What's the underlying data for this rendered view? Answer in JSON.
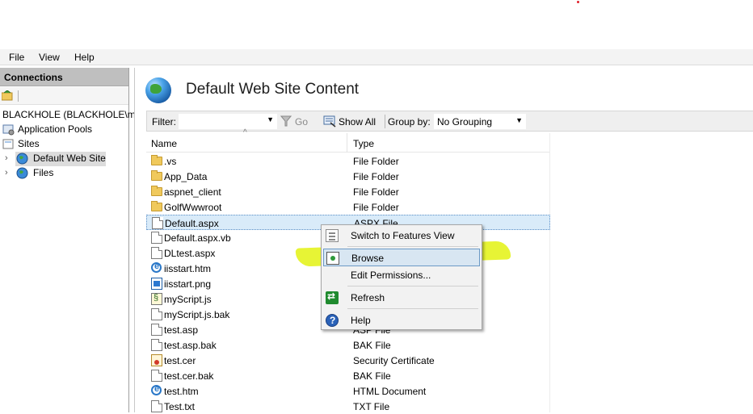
{
  "menubar": {
    "items": [
      "File",
      "View",
      "Help"
    ]
  },
  "connections": {
    "header": "Connections",
    "tree": {
      "server": "BLACKHOLE (BLACKHOLE\\m",
      "app_pools": "Application Pools",
      "sites": "Sites",
      "default_site": "Default Web Site",
      "files": "Files"
    }
  },
  "content": {
    "title": "Default Web Site Content",
    "filter": {
      "label": "Filter:",
      "value": "",
      "go_label": "Go",
      "show_all_label": "Show All",
      "group_by_label": "Group by:",
      "group_by_value": "No Grouping"
    },
    "columns": {
      "name": "Name",
      "type": "Type"
    },
    "rows": [
      {
        "name": ".vs",
        "type": "File Folder",
        "icon": "folder-icon"
      },
      {
        "name": "App_Data",
        "type": "File Folder",
        "icon": "folder-icon"
      },
      {
        "name": "aspnet_client",
        "type": "File Folder",
        "icon": "folder-icon"
      },
      {
        "name": "GolfWwwroot",
        "type": "File Folder",
        "icon": "folder-icon"
      },
      {
        "name": "Default.aspx",
        "type": "ASPX File",
        "icon": "document-icon",
        "selected": true
      },
      {
        "name": "Default.aspx.vb",
        "type": "",
        "icon": "document-icon"
      },
      {
        "name": "DLtest.aspx",
        "type": "",
        "icon": "document-icon"
      },
      {
        "name": "iisstart.htm",
        "type": "",
        "icon": "ie-document-icon"
      },
      {
        "name": "iisstart.png",
        "type": "",
        "icon": "image-icon"
      },
      {
        "name": "myScript.js",
        "type": "",
        "icon": "script-icon"
      },
      {
        "name": "myScript.js.bak",
        "type": "",
        "icon": "document-icon"
      },
      {
        "name": "test.asp",
        "type": "ASP File",
        "icon": "document-icon"
      },
      {
        "name": "test.asp.bak",
        "type": "BAK File",
        "icon": "document-icon"
      },
      {
        "name": "test.cer",
        "type": "Security Certificate",
        "icon": "certificate-icon"
      },
      {
        "name": "test.cer.bak",
        "type": "BAK File",
        "icon": "document-icon"
      },
      {
        "name": "test.htm",
        "type": "HTML Document",
        "icon": "ie-document-icon"
      },
      {
        "name": "Test.txt",
        "type": "TXT File",
        "icon": "document-icon"
      }
    ]
  },
  "context_menu": {
    "items": [
      {
        "label": "Switch to Features View",
        "icon": "features-view-icon"
      },
      {
        "label": "Browse",
        "icon": "browse-icon",
        "highlighted": true
      },
      {
        "label": "Edit Permissions...",
        "icon": ""
      },
      {
        "label": "Refresh",
        "icon": "refresh-icon"
      },
      {
        "label": "Help",
        "icon": "help-icon"
      }
    ]
  },
  "colors": {
    "selection": "#d9ebf9",
    "highlighter": "#e2f208",
    "connections_header": "#bfbfbf"
  }
}
